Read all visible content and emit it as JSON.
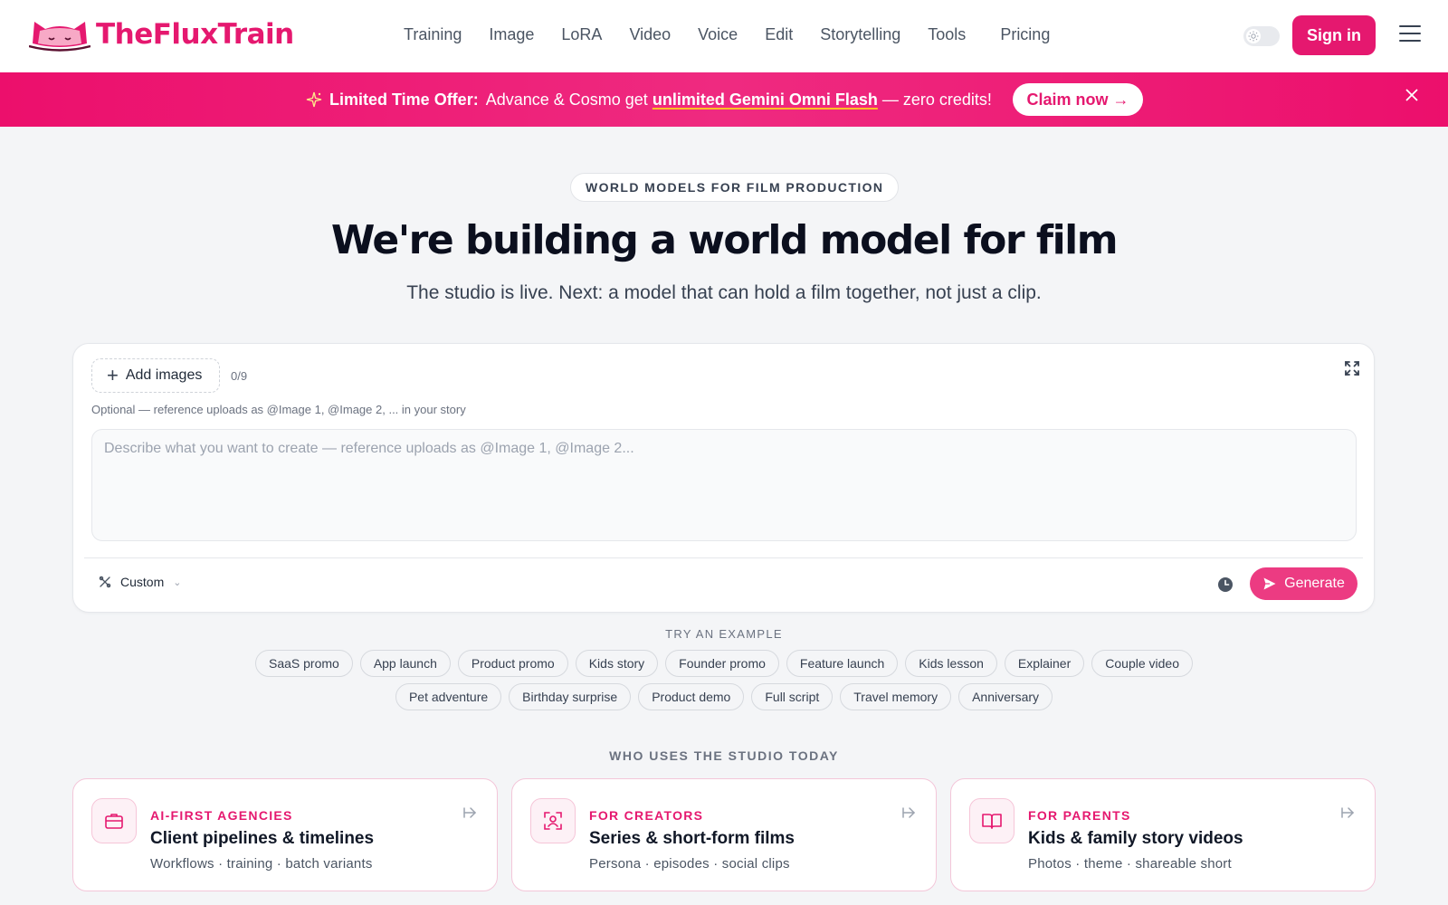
{
  "brand": {
    "name": "TheFluxTrain",
    "color": "#e5186f"
  },
  "nav": {
    "items": [
      "Training",
      "Image",
      "LoRA",
      "Video",
      "Voice",
      "Edit",
      "Storytelling",
      "Tools"
    ],
    "pricing": "Pricing"
  },
  "header": {
    "theme_toggle_icon": "sun-icon",
    "signin_label": "Sign in",
    "menu_icon": "hamburger-icon"
  },
  "promo": {
    "strong": "Limited Time Offer:",
    "text_before": "Advance & Cosmo get",
    "highlight": "unlimited Gemini Omni Flash",
    "text_after": "— zero credits!",
    "cta": "Claim now →",
    "colors": {
      "background": "#ec0f6c",
      "underline": "#fbbf24"
    }
  },
  "hero": {
    "eyebrow": "WORLD MODELS FOR FILM PRODUCTION",
    "title": "We're building a world model for film",
    "subtitle": "The studio is live. Next: a model that can hold a film together, not just a clip."
  },
  "composer": {
    "add_images_label": "Add images",
    "count": "0/9",
    "hint": "Optional — reference uploads as @Image 1, @Image 2, ... in your story",
    "prompt_placeholder": "Describe what you want to create — reference uploads as @Image 1, @Image 2...",
    "prompt_value": "",
    "mode": "Custom",
    "generate_label": "Generate",
    "accent": "#ec3b82"
  },
  "examples": {
    "label": "TRY AN EXAMPLE",
    "row1": [
      "SaaS promo",
      "App launch",
      "Product promo",
      "Kids story",
      "Founder promo",
      "Feature launch",
      "Kids lesson",
      "Explainer",
      "Couple video"
    ],
    "row2": [
      "Pet adventure",
      "Birthday surprise",
      "Product demo",
      "Full script",
      "Travel memory",
      "Anniversary"
    ]
  },
  "who": {
    "label": "WHO USES THE STUDIO TODAY",
    "cards": [
      {
        "icon": "briefcase-icon",
        "eyebrow": "AI-FIRST AGENCIES",
        "title": "Client pipelines & timelines",
        "sub": "Workflows · training · batch variants"
      },
      {
        "icon": "user-scan-icon",
        "eyebrow": "FOR CREATORS",
        "title": "Series & short-form films",
        "sub": "Persona · episodes · social clips"
      },
      {
        "icon": "open-book-icon",
        "eyebrow": "FOR PARENTS",
        "title": "Kids & family story videos",
        "sub": "Photos · theme · shareable short"
      }
    ]
  }
}
